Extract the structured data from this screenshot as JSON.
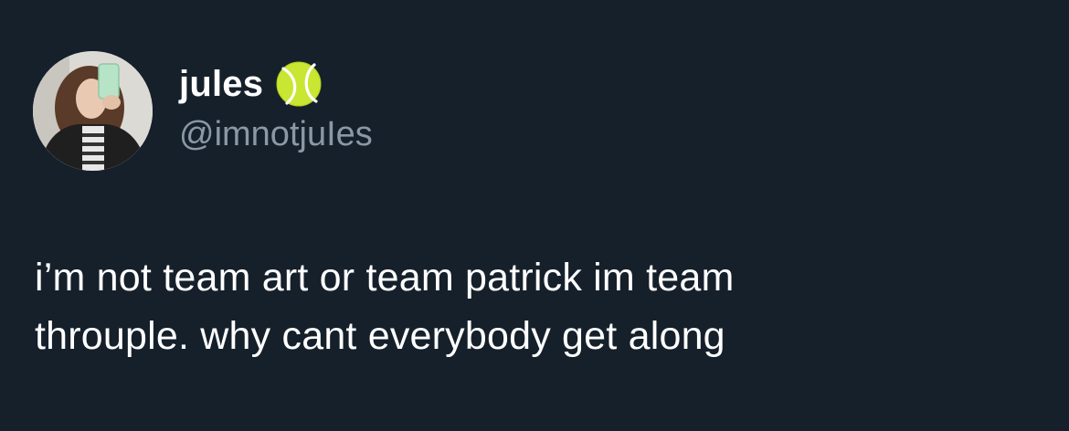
{
  "tweet": {
    "author": {
      "display_name": "jules",
      "handle": "@imnotjuIes",
      "name_emoji_icon": "tennis-ball-icon",
      "avatar_icon": "profile-photo"
    },
    "text_lines": [
      "i’m not team art or team patrick im team",
      "throuple. why cant everybody get along"
    ]
  },
  "colors": {
    "background": "#15202b",
    "text_primary": "#ffffff",
    "text_secondary": "#8b98a5",
    "tennis_ball": "#c8e632"
  }
}
